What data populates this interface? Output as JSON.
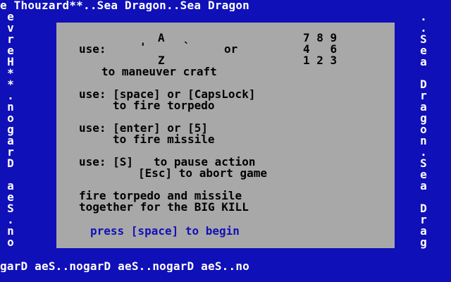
{
  "marquee": {
    "top": "e Thouzard**..Sea Dragon..Sea Dragon",
    "bottom": "garD aeS..nogarD aeS..nogarD aeS..no",
    "left": [
      "e",
      "v",
      "r",
      "e",
      "H",
      "*",
      "*",
      ".",
      "n",
      "o",
      "g",
      "a",
      "r",
      "D",
      "",
      "a",
      "e",
      "S",
      ".",
      "n",
      "o",
      ""
    ],
    "right": [
      ".",
      ".",
      "S",
      "e",
      "a",
      "",
      "D",
      "r",
      "a",
      "g",
      "o",
      "n",
      ".",
      "S",
      "e",
      "a",
      "",
      "D",
      "r",
      "a",
      "g",
      ""
    ]
  },
  "instructions": {
    "maneuver": {
      "row1_left": "A",
      "row1_right": "7 8 9",
      "row2_use": "use:",
      "row2_left_key": "'",
      "row2_right_key": "`",
      "row2_or": "or",
      "row2_numpad": "4   6",
      "row3_left": "Z",
      "row3_right": "1 2 3",
      "caption": "to maneuver craft"
    },
    "torpedo": {
      "line1": "use: [space] or [CapsLock]",
      "line2": "to fire torpedo"
    },
    "missile": {
      "line1": "use: [enter] or [5]",
      "line2": "to fire missile"
    },
    "pause": {
      "line1": "use: [S]   to pause action",
      "line2": "[Esc] to abort game"
    },
    "bigkill": {
      "line1": "fire torpedo and missile",
      "line2": "together for the BIG KILL"
    },
    "prompt": "press [space] to begin"
  },
  "colors": {
    "background": "#1010b8",
    "panel": "#a8a8a8",
    "text_on_blue": "#ffffff",
    "text_on_panel": "#000000",
    "prompt": "#1010b8"
  }
}
